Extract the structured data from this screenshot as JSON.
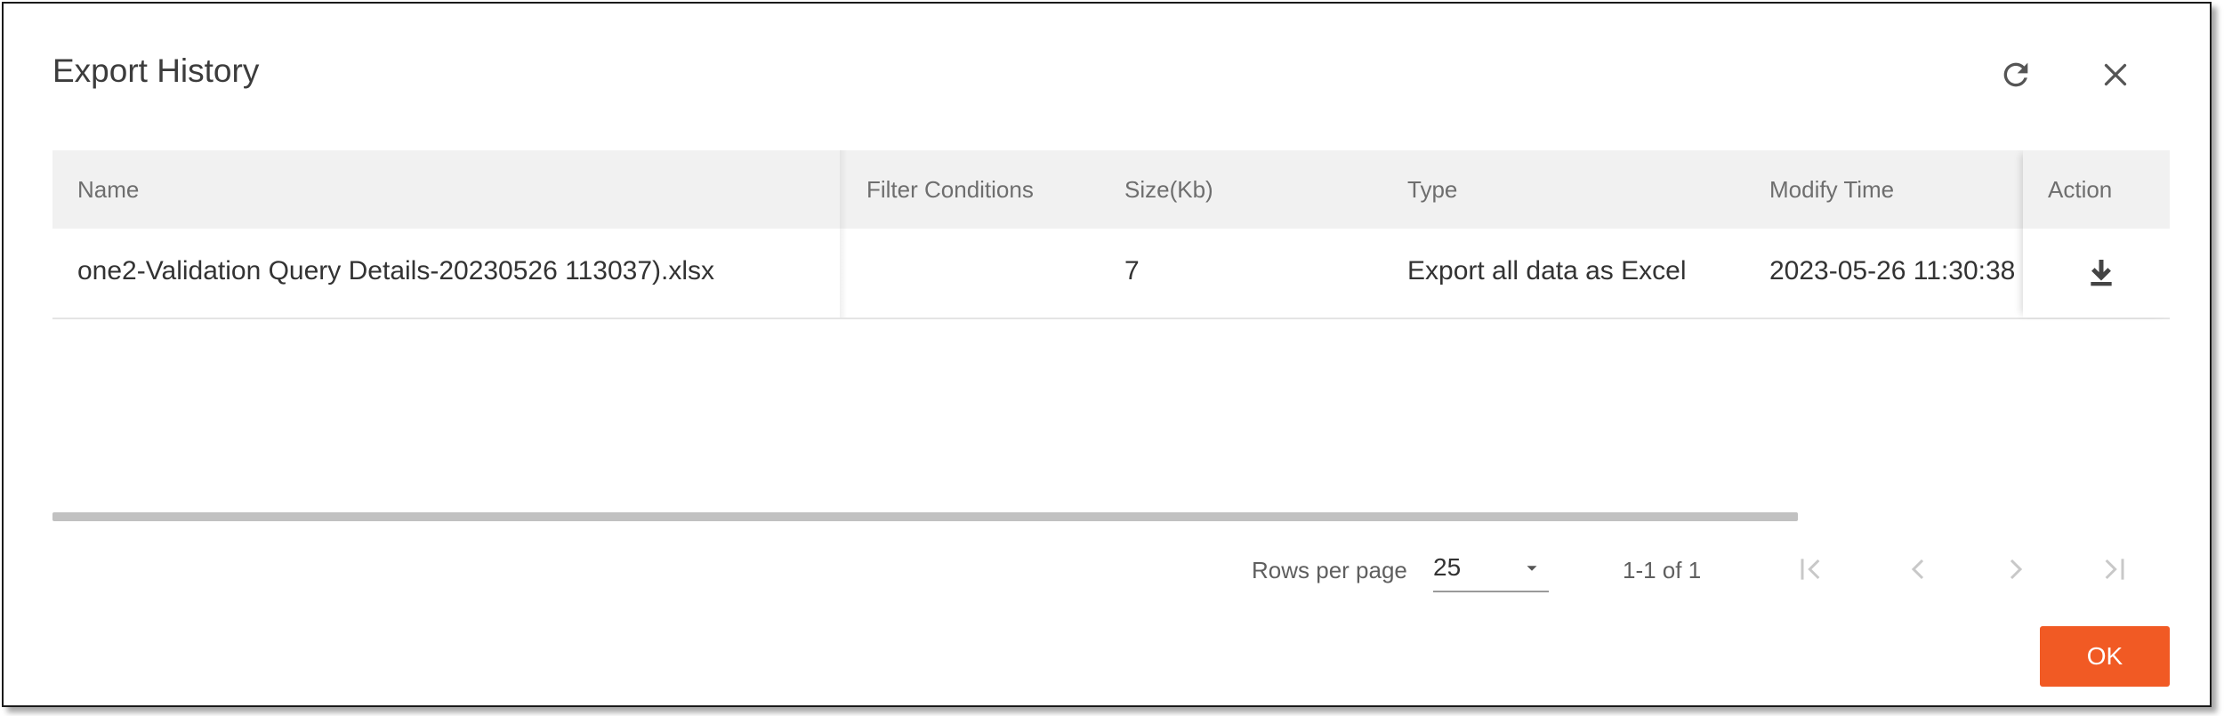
{
  "dialog": {
    "title": "Export History",
    "refresh_icon": "refresh-icon",
    "close_icon": "close-icon"
  },
  "table": {
    "columns": [
      "Name",
      "Filter Conditions",
      "Size(Kb)",
      "Type",
      "Modify Time",
      "Action"
    ],
    "rows": [
      {
        "name": "one2-Validation Query Details-20230526 113037).xlsx",
        "filter_conditions": "",
        "size": "7",
        "type": "Export all data as Excel",
        "modify_time": "2023-05-26 11:30:38",
        "action_icon": "download-icon"
      }
    ]
  },
  "pagination": {
    "rows_per_page_label": "Rows per page",
    "rows_per_page_value": "25",
    "range_label": "1-1 of 1"
  },
  "footer": {
    "ok_label": "OK"
  },
  "colors": {
    "accent": "#f15a24",
    "header_bg": "#f1f1f1",
    "scrollbar": "#c1c1c1"
  }
}
